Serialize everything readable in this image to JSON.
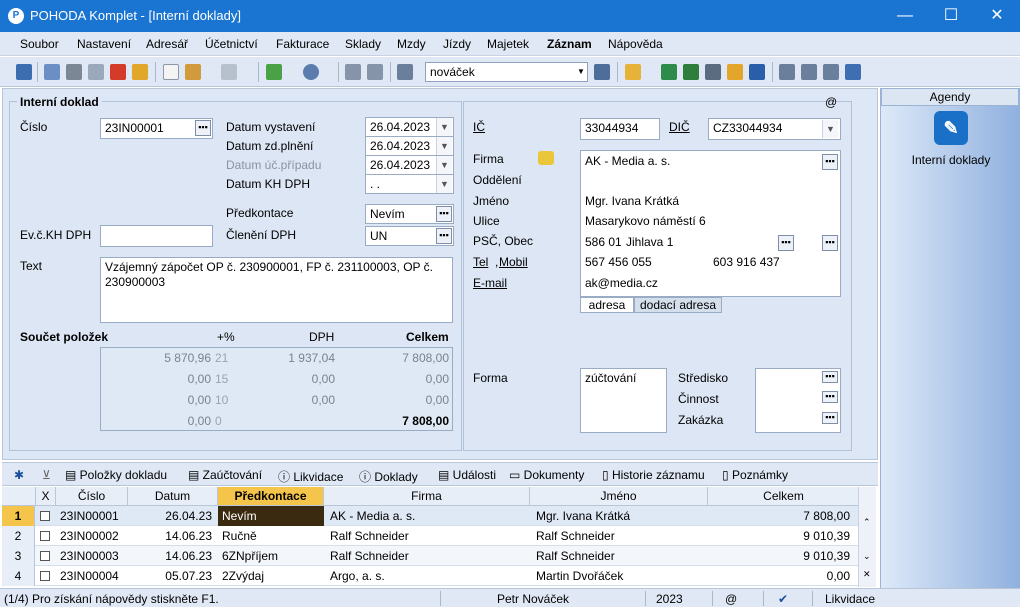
{
  "window": {
    "title": "POHODA Komplet - [Interní doklady]",
    "minimize": "—",
    "maximize": "☐",
    "close": "✕"
  },
  "menu": [
    "Soubor",
    "Nastavení",
    "Adresář",
    "Účetnictví",
    "Fakturace",
    "Sklady",
    "Mzdy",
    "Jízdy",
    "Majetek",
    "Záznam",
    "Nápověda"
  ],
  "toolbar": {
    "search_value": "nováček"
  },
  "form": {
    "section_title": "Interní doklad",
    "at_sign": "@",
    "cislo_label": "Číslo",
    "cislo_value": "23IN00001",
    "datum_vystaveni_label": "Datum vystavení",
    "datum_vystaveni": "26.04.2023",
    "datum_zd_label": "Datum zd.plnění",
    "datum_zd": "26.04.2023",
    "datum_uc_label": "Datum úč.případu",
    "datum_uc": "26.04.2023",
    "datum_kh_label": "Datum KH DPH",
    "datum_kh": " .  .",
    "predkontace_label": "Předkontace",
    "predkontace": "Nevím",
    "cleneni_label": "Členění DPH",
    "cleneni": "UN",
    "evc_label": "Ev.č.KH DPH",
    "evc": "",
    "text_label": "Text",
    "text": "Vzájemný zápočet OP č. 230900001, FP č. 231100003, OP č. 230900003",
    "soucet_label": "Součet položek",
    "col_pct": "+%",
    "col_dph": "DPH",
    "col_celkem": "Celkem",
    "sum_rows": [
      {
        "base": "5 870,96",
        "pct": "21",
        "dph": "1 937,04",
        "total": "7 808,00"
      },
      {
        "base": "0,00",
        "pct": "15",
        "dph": "0,00",
        "total": "0,00"
      },
      {
        "base": "0,00",
        "pct": "10",
        "dph": "0,00",
        "total": "0,00"
      },
      {
        "base": "0,00",
        "pct": "0",
        "dph": "",
        "total": "7 808,00"
      }
    ],
    "ic_label": "IČ",
    "ic": "33044934",
    "dic_label": "DIČ",
    "dic": "CZ33044934",
    "firma_label": "Firma",
    "firma": "AK - Media a. s.",
    "oddeleni_label": "Oddělení",
    "oddeleni": "",
    "jmeno_label": "Jméno",
    "jmeno": "Mgr. Ivana Krátká",
    "ulice_label": "Ulice",
    "ulice": "Masarykovo náměstí 6",
    "psc_label": "PSČ, Obec",
    "psc": "586 01",
    "obec": "Jihlava 1",
    "tel_label": "Tel",
    "mobil_label": "Mobil",
    "tel": "567 456 055",
    "mobil": "603 916 437",
    "email_label": "E-mail",
    "email": "ak@media.cz",
    "addr_tab1": "adresa",
    "addr_tab2": "dodací adresa",
    "forma_label": "Forma",
    "forma": "zúčtování",
    "stredisko_label": "Středisko",
    "cinnost_label": "Činnost",
    "zakazka_label": "Zakázka"
  },
  "agenda": {
    "header": "Agendy",
    "item": "Interní doklady"
  },
  "tabs": [
    "Položky dokladu",
    "Zaúčtování",
    "Likvidace",
    "Doklady",
    "Události",
    "Dokumenty",
    "Historie záznamu",
    "Poznámky"
  ],
  "table": {
    "headers": [
      "X",
      "Číslo",
      "Datum",
      "Předkontace",
      "Firma",
      "Jméno",
      "Celkem"
    ],
    "rows": [
      {
        "n": "1",
        "cislo": "23IN00001",
        "datum": "26.04.23",
        "pred": "Nevím",
        "firma": "AK - Media a. s.",
        "jmeno": "Mgr. Ivana Krátká",
        "celkem": "7 808,00"
      },
      {
        "n": "2",
        "cislo": "23IN00002",
        "datum": "14.06.23",
        "pred": "Ručně",
        "firma": "Ralf Schneider",
        "jmeno": "Ralf Schneider",
        "celkem": "9 010,39"
      },
      {
        "n": "3",
        "cislo": "23IN00003",
        "datum": "14.06.23",
        "pred": "6ZNpříjem",
        "firma": "Ralf Schneider",
        "jmeno": "Ralf Schneider",
        "celkem": "9 010,39"
      },
      {
        "n": "4",
        "cislo": "23IN00004",
        "datum": "05.07.23",
        "pred": "2Zvýdaj",
        "firma": "Argo, a. s.",
        "jmeno": "Martin Dvořáček",
        "celkem": "0,00"
      }
    ]
  },
  "status": {
    "hint": "(1/4) Pro získání nápovědy stiskněte F1.",
    "user": "Petr Nováček",
    "year": "2023",
    "at": "@",
    "check": "✔",
    "agenda": "Likvidace"
  }
}
